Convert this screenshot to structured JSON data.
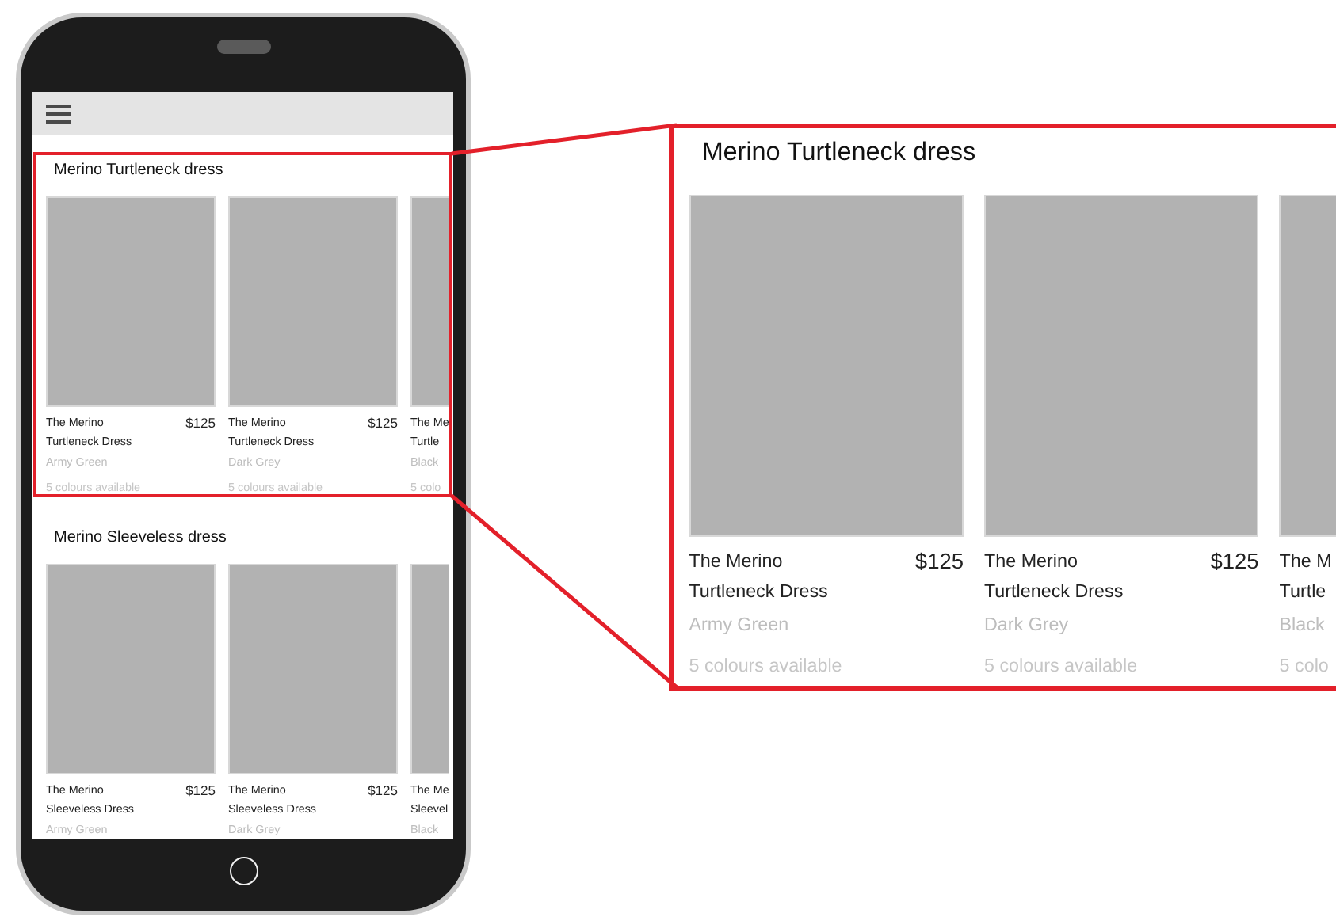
{
  "phone": {
    "sections": [
      {
        "title": "Merino Turtleneck dress",
        "highlighted": true,
        "products": [
          {
            "name_lines": [
              "The Merino",
              "Turtleneck Dress"
            ],
            "price": "$125",
            "colour": "Army Green",
            "availability": "5 colours available"
          },
          {
            "name_lines": [
              "The Merino",
              "Turtleneck Dress"
            ],
            "price": "$125",
            "colour": "Dark Grey",
            "availability": "5 colours available"
          },
          {
            "name_lines": [
              "The Me",
              "Turtle"
            ],
            "colour": "Black",
            "availability": "5 colo"
          }
        ]
      },
      {
        "title": "Merino Sleeveless dress",
        "highlighted": false,
        "products": [
          {
            "name_lines": [
              "The Merino",
              "Sleeveless Dress"
            ],
            "price": "$125",
            "colour": "Army Green"
          },
          {
            "name_lines": [
              "The Merino",
              "Sleeveless Dress"
            ],
            "price": "$125",
            "colour": "Dark Grey"
          },
          {
            "name_lines": [
              "The Me",
              "Sleevel"
            ],
            "colour": "Black"
          }
        ]
      }
    ]
  },
  "callout": {
    "title": "Merino Turtleneck dress",
    "products": [
      {
        "name_lines": [
          "The Merino",
          "Turtleneck Dress"
        ],
        "price": "$125",
        "colour": "Army Green",
        "availability": "5 colours available"
      },
      {
        "name_lines": [
          "The Merino",
          "Turtleneck Dress"
        ],
        "price": "$125",
        "colour": "Dark Grey",
        "availability": "5 colours available"
      },
      {
        "name_lines": [
          "The M",
          "Turtle"
        ],
        "colour": "Black",
        "availability": "5 colo"
      }
    ]
  }
}
